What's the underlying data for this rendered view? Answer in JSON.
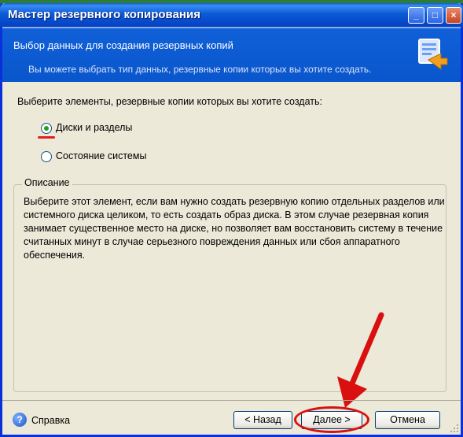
{
  "window": {
    "title": "Мастер резервного копирования"
  },
  "header": {
    "title": "Выбор данных для создания резервных копий",
    "subtitle": "Вы можете выбрать тип данных, резервные копии которых вы хотите создать."
  },
  "content": {
    "prompt": "Выберите элементы, резервные копии которых вы хотите создать:",
    "options": [
      {
        "label": "Диски и разделы",
        "selected": true
      },
      {
        "label": "Состояние системы",
        "selected": false
      }
    ],
    "description": {
      "legend": "Описание",
      "text": "Выберите этот элемент, если вам нужно создать резервную копию отдельных разделов или системного диска целиком, то есть создать образ диска. В этом случае резервная копия занимает существенное место на диске, но позволяет вам восстановить систему в течение считанных минут в случае серьезного повреждения данных или сбоя аппаратного обеспечения."
    }
  },
  "footer": {
    "help_label": "Справка",
    "back_label": "< Назад",
    "next_label": "Далее >",
    "cancel_label": "Отмена"
  },
  "colors": {
    "title_bar": "#0b5bd6",
    "header_bg": "#0a56cc",
    "annotation_red": "#e02020"
  }
}
